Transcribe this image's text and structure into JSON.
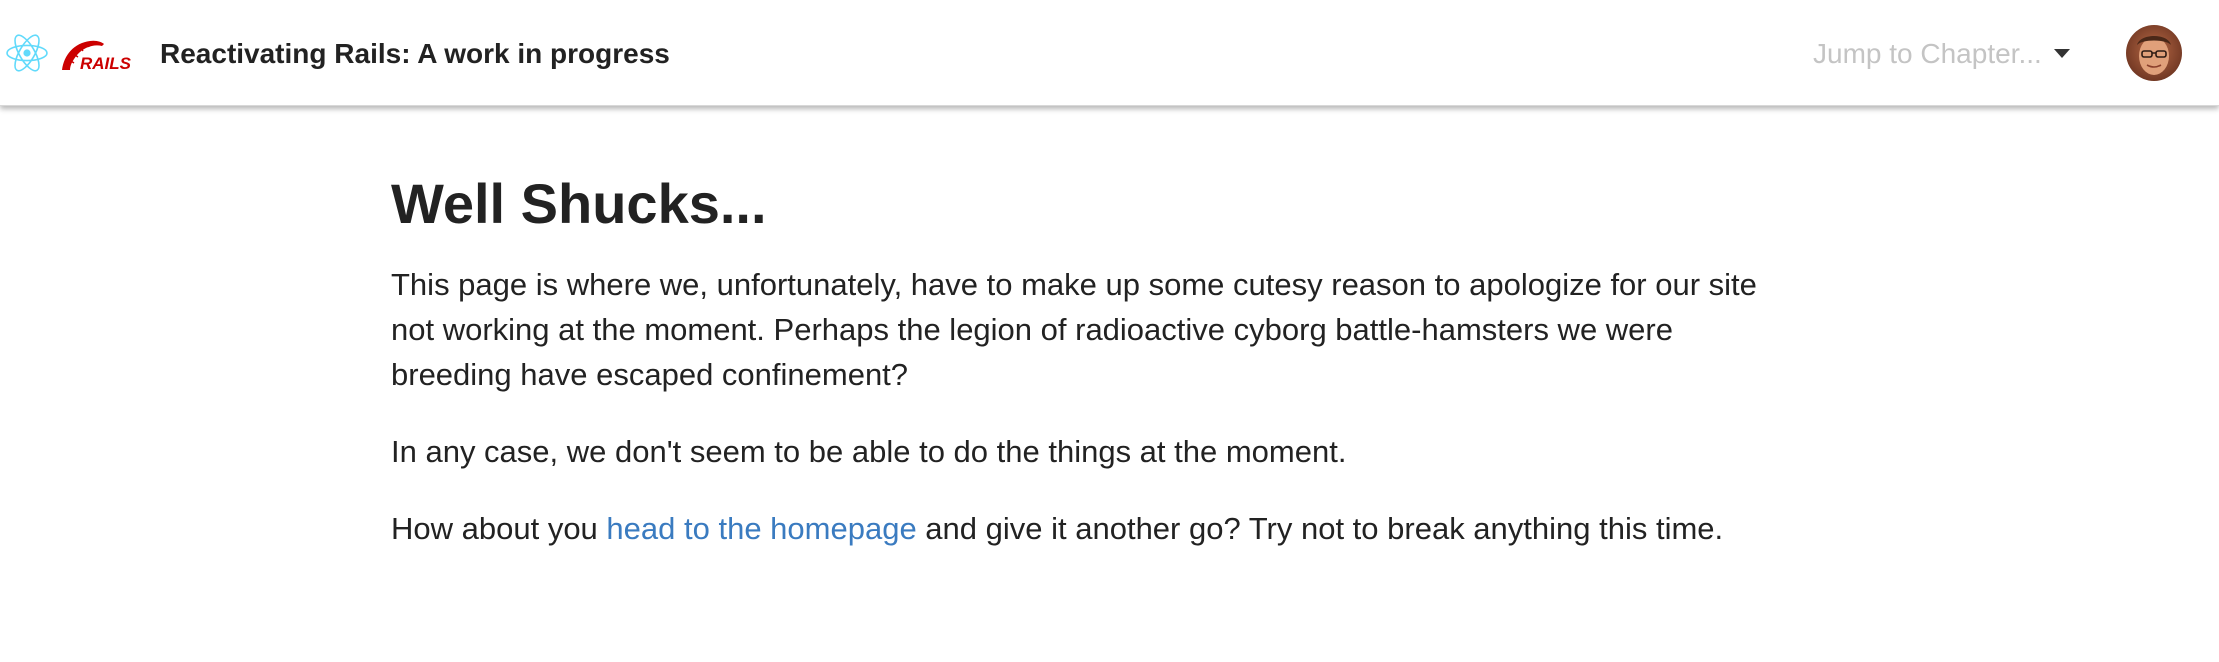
{
  "header": {
    "title": "Reactivating Rails: A work in progress",
    "logos": [
      "react-icon",
      "rails-logo"
    ],
    "rails_logo_text": "RAILS",
    "chapter_select": {
      "placeholder": "Jump to Chapter...",
      "icon": "chevron-down-icon"
    },
    "avatar_icon": "user-avatar"
  },
  "main": {
    "heading": "Well Shucks...",
    "paragraph1": "This page is where we, unfortunately, have to make up some cutesy reason to apologize for our site not working at the moment. Perhaps the legion of radioactive cyborg battle-hamsters we were breeding have escaped confinement?",
    "paragraph2": "In any case, we don't seem to be able to do the things at the moment.",
    "paragraph3": {
      "before": "How about you ",
      "link": "head to the homepage",
      "after": " and give it another go? Try not to break anything this time."
    }
  },
  "colors": {
    "react_blue": "#61dafb",
    "rails_red": "#cc0000",
    "link_blue": "#3a7bc0",
    "placeholder_gray": "#c4c4c4",
    "text": "#222222"
  }
}
